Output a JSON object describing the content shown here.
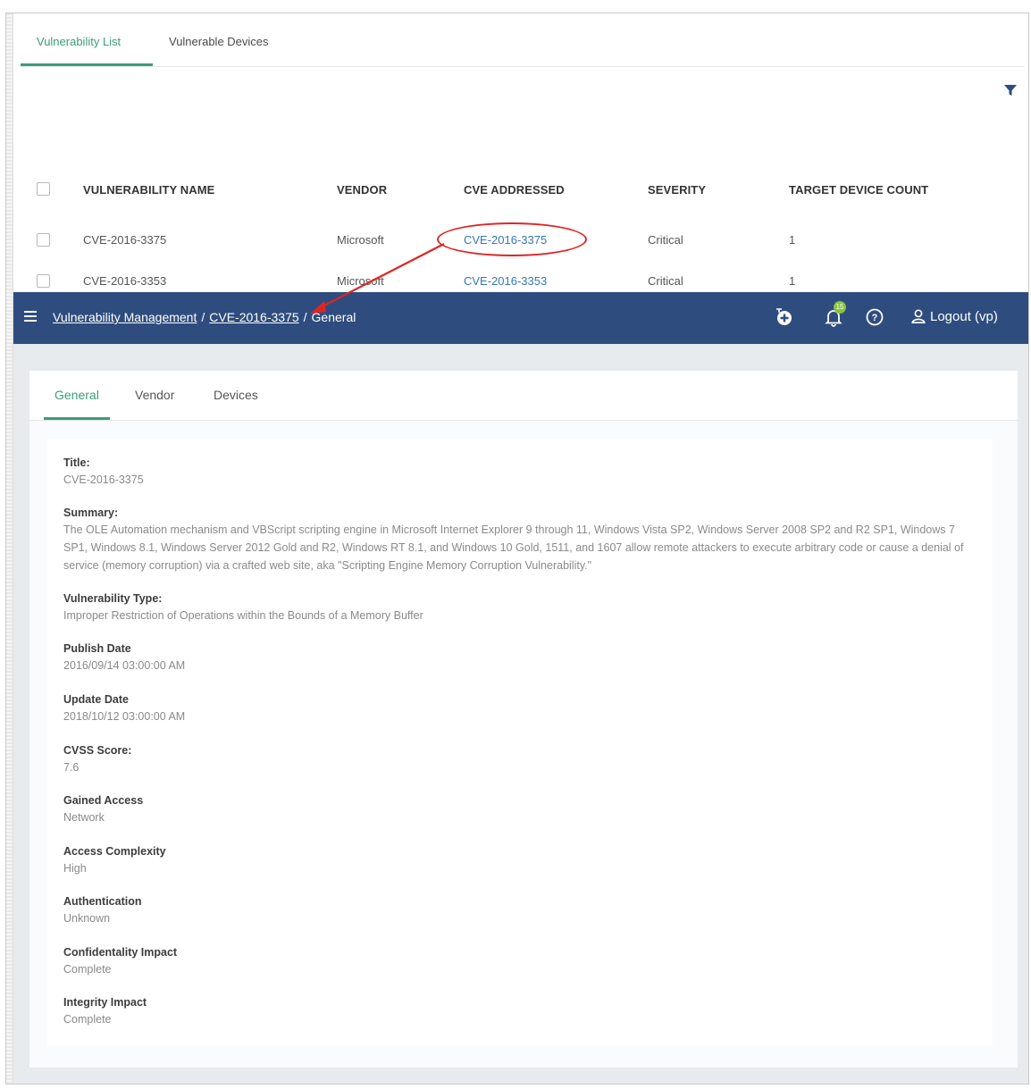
{
  "list_tabs": [
    "Vulnerability List",
    "Vulnerable Devices"
  ],
  "table": {
    "headers": [
      "VULNERABILITY NAME",
      "VENDOR",
      "CVE ADDRESSED",
      "SEVERITY",
      "TARGET DEVICE COUNT"
    ],
    "rows": [
      {
        "name": "CVE-2016-3375",
        "vendor": "Microsoft",
        "cve": "CVE-2016-3375",
        "severity": "Critical",
        "count": "1"
      },
      {
        "name": "CVE-2016-3353",
        "vendor": "Microsoft",
        "cve": "CVE-2016-3353",
        "severity": "Critical",
        "count": "1"
      }
    ]
  },
  "header": {
    "breadcrumb": [
      "Vulnerability Management",
      "CVE-2016-3375",
      "General"
    ],
    "separator": "/",
    "notification_count": "15",
    "logout_label": "Logout (vp)"
  },
  "detail_tabs": [
    "General",
    "Vendor",
    "Devices"
  ],
  "fields": [
    {
      "label": "Title:",
      "value": "CVE-2016-3375"
    },
    {
      "label": "Summary:",
      "value": "The OLE Automation mechanism and VBScript scripting engine in Microsoft Internet Explorer 9 through 11, Windows Vista SP2, Windows Server 2008 SP2 and R2 SP1, Windows 7 SP1, Windows 8.1, Windows Server 2012 Gold and R2, Windows RT 8.1, and Windows 10 Gold, 1511, and 1607 allow remote attackers to execute arbitrary code or cause a denial of service (memory corruption) via a crafted web site, aka \"Scripting Engine Memory Corruption Vulnerability.\""
    },
    {
      "label": "Vulnerability Type:",
      "value": "Improper Restriction of Operations within the Bounds of a Memory Buffer"
    },
    {
      "label": "Publish Date",
      "value": "2016/09/14 03:00:00 AM"
    },
    {
      "label": "Update Date",
      "value": "2018/10/12 03:00:00 AM"
    },
    {
      "label": "CVSS Score:",
      "value": "7.6"
    },
    {
      "label": "Gained Access",
      "value": "Network"
    },
    {
      "label": "Access Complexity",
      "value": "High"
    },
    {
      "label": "Authentication",
      "value": "Unknown"
    },
    {
      "label": "Confidentality Impact",
      "value": "Complete"
    },
    {
      "label": "Integrity Impact",
      "value": "Complete"
    }
  ],
  "colors": {
    "accent": "#3b9c7c",
    "header_bg": "#2e4d7e",
    "link": "#3576b8",
    "annotation": "#e02424"
  }
}
